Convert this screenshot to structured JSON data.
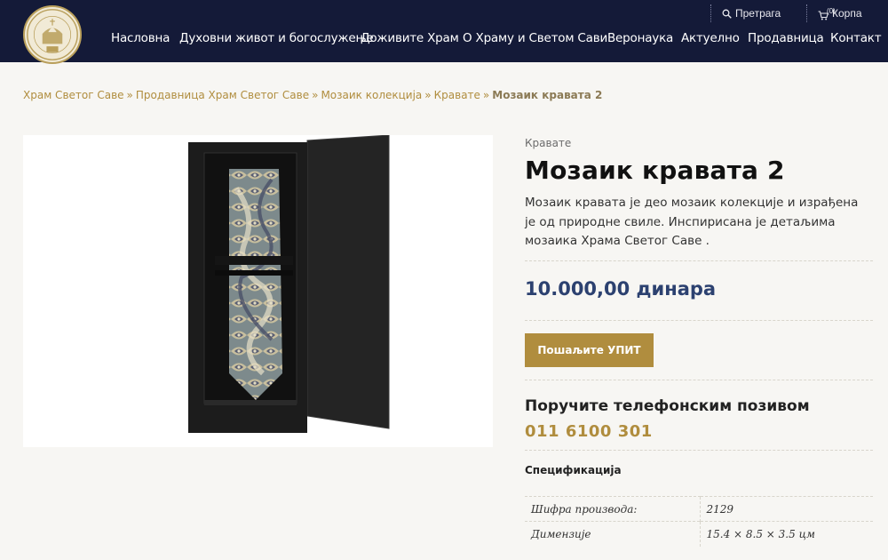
{
  "header": {
    "utility": {
      "search_label": "Претрага",
      "cart_count": "(0)",
      "cart_label": "Корпа"
    },
    "nav": [
      "Насловна",
      "Духовни живот и богослужење",
      "Доживите Храм",
      "О Храму и Светом Сави",
      "Веронаука",
      "Актуелно",
      "Продавница",
      "Контакт"
    ]
  },
  "breadcrumb": {
    "links": [
      "Храм Светог Саве",
      "Продавница Храм Светог Саве",
      "Мозаик колекција",
      "Кравате"
    ],
    "separator": "»",
    "current": "Мозаик кравата 2"
  },
  "product": {
    "category": "Кравате",
    "title": "Мозаик кравата 2",
    "description": "Мозаик кравата је  део мозаик колекције и израђена је од природне свиле. Инспирисана је детаљима мозаика Храма Светог Саве .",
    "price": "10.000,00 динара",
    "inquiry_button": "Пошаљите УПИТ",
    "phone_heading": "Поручите телефонским позивом",
    "phone_number": "011 6100 301",
    "spec_title": "Спецификација",
    "specs": [
      {
        "label": "Шифра производа:",
        "value": "2129"
      },
      {
        "label": "Димензије",
        "value": "15.4 × 8.5 × 3.5 цм"
      }
    ]
  },
  "colors": {
    "header_bg": "#141a38",
    "accent_gold": "#b08d3e",
    "price_blue": "#2c4170",
    "page_bg": "#f7f6f3"
  },
  "icons": {
    "search": "search-icon",
    "cart": "cart-icon",
    "logo": "temple-logo"
  }
}
